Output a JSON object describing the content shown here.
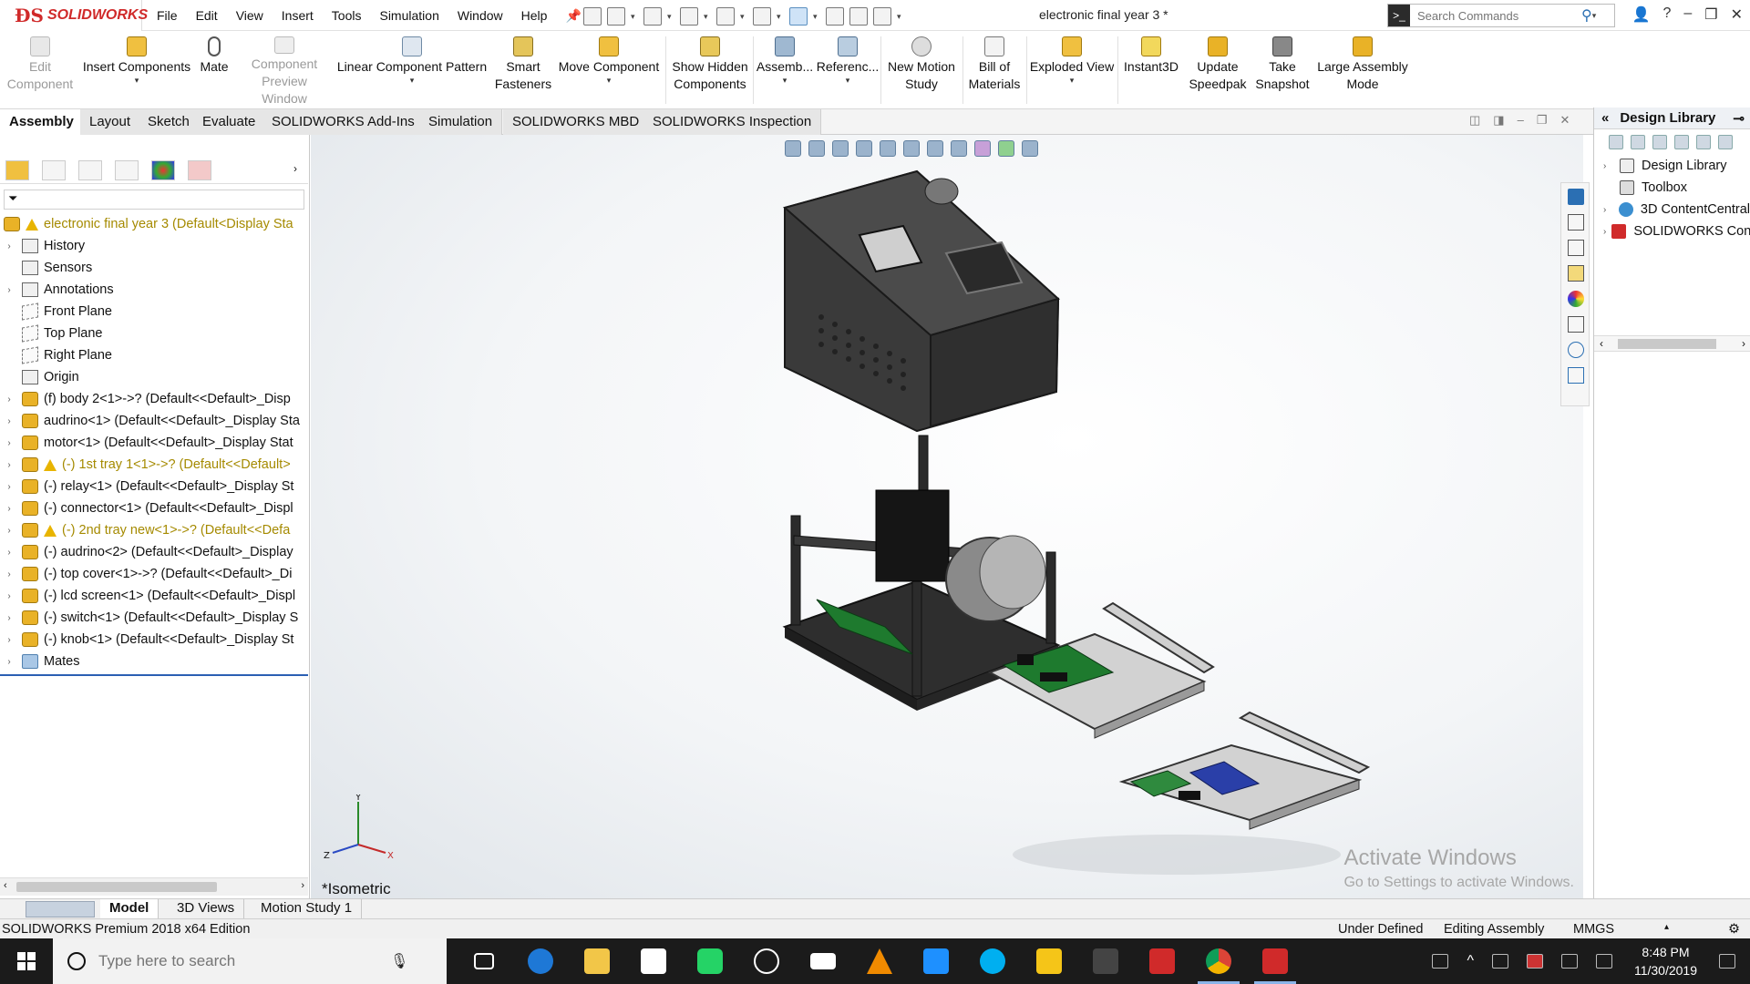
{
  "app": {
    "brand": "SOLIDWORKS",
    "document_title": "electronic final year 3 *"
  },
  "menu": [
    "File",
    "Edit",
    "View",
    "Insert",
    "Tools",
    "Simulation",
    "Window",
    "Help"
  ],
  "search": {
    "placeholder": "Search Commands"
  },
  "commands": [
    {
      "label": "Edit Component",
      "enabled": false
    },
    {
      "label": "Insert Components",
      "enabled": true
    },
    {
      "label": "Mate",
      "enabled": true
    },
    {
      "label": "Component Preview Window",
      "enabled": false
    },
    {
      "label": "Linear Component Pattern",
      "enabled": true
    },
    {
      "label": "Smart Fasteners",
      "enabled": true
    },
    {
      "label": "Move Component",
      "enabled": true
    },
    {
      "label": "Show Hidden Components",
      "enabled": true
    },
    {
      "label": "Assemb...",
      "enabled": true
    },
    {
      "label": "Referenc...",
      "enabled": true
    },
    {
      "label": "New Motion Study",
      "enabled": true
    },
    {
      "label": "Bill of Materials",
      "enabled": true
    },
    {
      "label": "Exploded View",
      "enabled": true
    },
    {
      "label": "Instant3D",
      "enabled": true
    },
    {
      "label": "Update Speedpak",
      "enabled": true
    },
    {
      "label": "Take Snapshot",
      "enabled": true
    },
    {
      "label": "Large Assembly Mode",
      "enabled": true
    }
  ],
  "tabs": [
    "Assembly",
    "Layout",
    "Sketch",
    "Evaluate",
    "SOLIDWORKS Add-Ins",
    "Simulation",
    "SOLIDWORKS MBD",
    "SOLIDWORKS Inspection"
  ],
  "active_tab": "Assembly",
  "feature_tree": {
    "root": "electronic final year 3  (Default<Display Sta",
    "items": [
      {
        "label": "History",
        "type": "folder",
        "expand": true
      },
      {
        "label": "Sensors",
        "type": "folder",
        "expand": false
      },
      {
        "label": "Annotations",
        "type": "folder",
        "expand": true
      },
      {
        "label": "Front Plane",
        "type": "plane",
        "expand": false
      },
      {
        "label": "Top Plane",
        "type": "plane",
        "expand": false
      },
      {
        "label": "Right Plane",
        "type": "plane",
        "expand": false
      },
      {
        "label": "Origin",
        "type": "origin",
        "expand": false
      },
      {
        "label": "(f) body 2<1>->? (Default<<Default>_Disp",
        "type": "part",
        "expand": true
      },
      {
        "label": "audrino<1> (Default<<Default>_Display Sta",
        "type": "part",
        "expand": true
      },
      {
        "label": "motor<1> (Default<<Default>_Display Stat",
        "type": "part",
        "expand": true
      },
      {
        "label": "(-) 1st tray 1<1>->? (Default<<Default>",
        "type": "part",
        "expand": true,
        "warning": true
      },
      {
        "label": "(-) relay<1> (Default<<Default>_Display St",
        "type": "part",
        "expand": true
      },
      {
        "label": "(-) connector<1> (Default<<Default>_Displ",
        "type": "part",
        "expand": true
      },
      {
        "label": "(-) 2nd tray new<1>->? (Default<<Defa",
        "type": "part",
        "expand": true,
        "warning": true
      },
      {
        "label": "(-) audrino<2> (Default<<Default>_Display",
        "type": "part",
        "expand": true
      },
      {
        "label": "(-) top cover<1>->? (Default<<Default>_Di",
        "type": "part",
        "expand": true
      },
      {
        "label": "(-) lcd screen<1> (Default<<Default>_Displ",
        "type": "part",
        "expand": true
      },
      {
        "label": "(-) switch<1> (Default<<Default>_Display S",
        "type": "part",
        "expand": true
      },
      {
        "label": "(-) knob<1> (Default<<Default>_Display St",
        "type": "part",
        "expand": true
      },
      {
        "label": "Mates",
        "type": "mates",
        "expand": true
      }
    ]
  },
  "viewport": {
    "view_name": "*Isometric",
    "watermark_title": "Activate Windows",
    "watermark_sub": "Go to Settings to activate Windows."
  },
  "design_library": {
    "title": "Design Library",
    "items": [
      "Design Library",
      "Toolbox",
      "3D ContentCentral",
      "SOLIDWORKS Content"
    ]
  },
  "bottom_tabs": [
    "Model",
    "3D Views",
    "Motion Study 1"
  ],
  "status": {
    "edition": "SOLIDWORKS Premium 2018 x64 Edition",
    "state": "Under Defined",
    "mode": "Editing Assembly",
    "units": "MMGS"
  },
  "taskbar": {
    "search_placeholder": "Type here to search",
    "time": "8:48 PM",
    "date": "11/30/2019"
  },
  "colors": {
    "brand_red": "#d02a2a",
    "warning_yellow": "#e8b400",
    "tree_warning_text": "#a58a00",
    "taskbar_bg": "#1b1b1b"
  }
}
